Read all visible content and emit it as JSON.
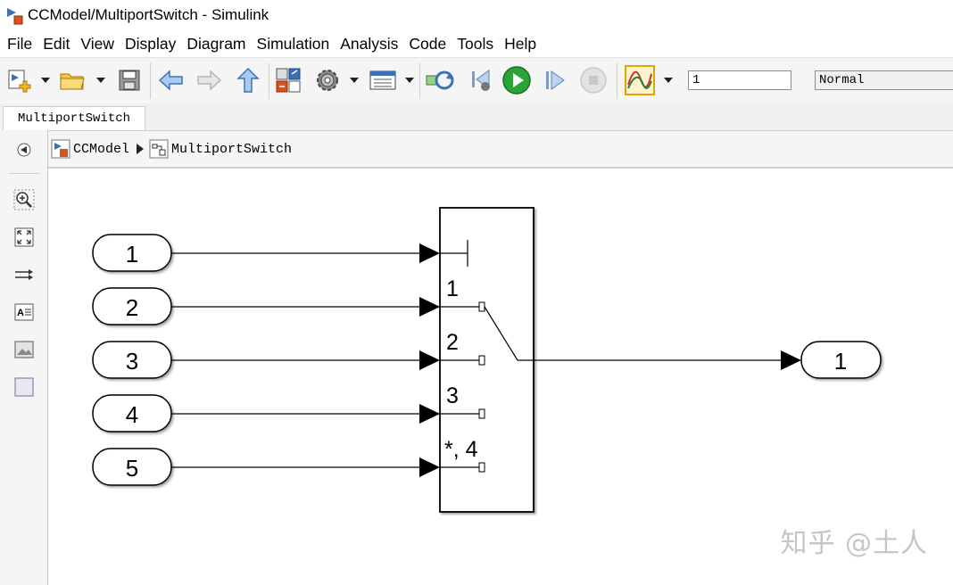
{
  "window": {
    "title": "CCModel/MultiportSwitch - Simulink"
  },
  "menu": {
    "items": [
      "File",
      "Edit",
      "View",
      "Display",
      "Diagram",
      "Simulation",
      "Analysis",
      "Code",
      "Tools",
      "Help"
    ]
  },
  "toolbar": {
    "icons": [
      "new-model-icon",
      "open-folder-icon",
      "save-icon",
      "back-arrow-icon",
      "forward-arrow-icon",
      "up-arrow-icon",
      "library-browser-icon",
      "model-settings-gear-icon",
      "model-explorer-icon",
      "update-diagram-icon",
      "step-back-icon",
      "run-icon",
      "step-forward-icon",
      "stop-icon",
      "scope-icon"
    ],
    "stop_time_value": "1",
    "simulation_mode_value": "Normal"
  },
  "tabs": [
    {
      "label": "MultiportSwitch"
    }
  ],
  "breadcrumb": {
    "items": [
      "CCModel",
      "MultiportSwitch"
    ]
  },
  "left_palette": {
    "icons": [
      "hide-browser-icon",
      "zoom-icon",
      "fit-to-view-icon",
      "signal-routing-icon",
      "annotation-icon",
      "image-icon",
      "area-icon"
    ]
  },
  "diagram": {
    "inports": [
      "1",
      "2",
      "3",
      "4",
      "5"
    ],
    "switch_port_labels": [
      "1",
      "2",
      "3",
      "*, 4"
    ],
    "outport": "1"
  },
  "watermark": "知乎 @土人",
  "colors": {
    "run_green": "#2aa339",
    "stop_gray": "#c8c8c8",
    "toolbar_bg": "#f5f5f5",
    "block_border": "#000000"
  }
}
